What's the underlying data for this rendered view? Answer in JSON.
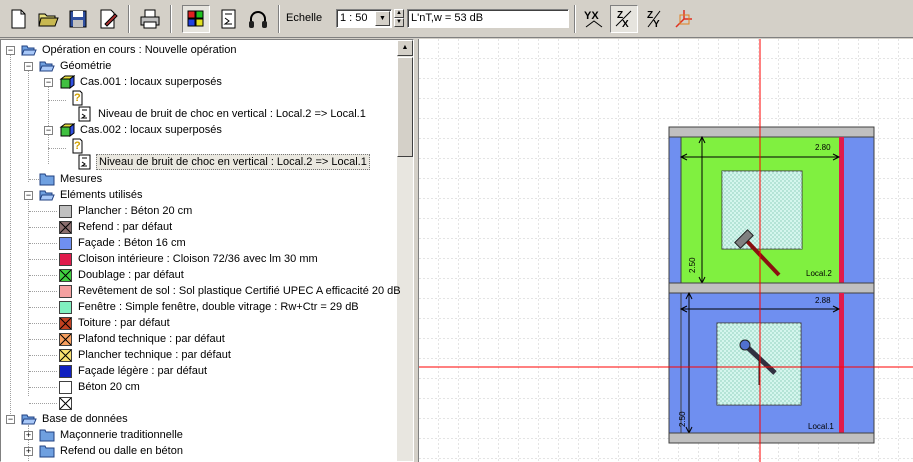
{
  "toolbar": {
    "buttons": [
      {
        "name": "new-document-icon"
      },
      {
        "name": "open-folder-icon"
      },
      {
        "name": "save-icon"
      },
      {
        "name": "edit-document-icon"
      },
      {
        "name": "print-icon"
      },
      {
        "name": "materials-icon",
        "pressed": true
      },
      {
        "name": "calculator-icon"
      },
      {
        "name": "headphones-icon"
      }
    ],
    "view_buttons": [
      {
        "name": "view-yx-icon",
        "label": "YX"
      },
      {
        "name": "view-zx-icon",
        "label": "ZX",
        "pressed": true
      },
      {
        "name": "view-zy-icon",
        "label": "ZY"
      },
      {
        "name": "view-3d-icon",
        "label": ""
      }
    ],
    "echelle_label": "Echelle",
    "scale_value": "1 : 50",
    "result_value": "L'nT,w = 53 dB"
  },
  "tree": {
    "root": "Opération en cours : Nouvelle opération",
    "geometrie": "Géométrie",
    "cas1": "Cas.001 : locaux superposés",
    "cas1_child": "Niveau de bruit de choc en vertical : Local.2 => Local.1",
    "cas2": "Cas.002 : locaux superposés",
    "cas2_child": "Niveau de bruit de choc en vertical : Local.2 => Local.1",
    "mesures": "Mesures",
    "elements": "Eléments utilisés",
    "element_items": [
      {
        "label": "Plancher : Béton 20 cm",
        "color": "#c0c0c0",
        "pattern": "none"
      },
      {
        "label": "Refend : par défaut",
        "color": "#8b6e6e",
        "pattern": "cross"
      },
      {
        "label": "Façade : Béton 16 cm",
        "color": "#6f8ff0",
        "pattern": "none"
      },
      {
        "label": "Cloison intérieure : Cloison  72/36 avec lm 30 mm",
        "color": "#e01b4c",
        "pattern": "none"
      },
      {
        "label": "Doublage : par défaut",
        "color": "#40d040",
        "pattern": "cross"
      },
      {
        "label": "Revêtement de sol : Sol plastique Certifié UPEC A efficacité 20 dB",
        "color": "#f4a0a0",
        "pattern": "none"
      },
      {
        "label": "Fenêtre : Simple fenêtre, double vitrage : Rw+Ctr = 29 dB",
        "color": "#80f0c0",
        "pattern": "none"
      },
      {
        "label": "Toiture : par défaut",
        "color": "#c04020",
        "pattern": "cross"
      },
      {
        "label": "Plafond technique : par défaut",
        "color": "#f8a060",
        "pattern": "cross"
      },
      {
        "label": "Plancher technique : par défaut",
        "color": "#f8e070",
        "pattern": "cross"
      },
      {
        "label": "Façade légère : par défaut",
        "color": "#1020c0",
        "pattern": "none"
      },
      {
        "label": "Béton 20 cm",
        "color": "#ffffff",
        "pattern": "none"
      },
      {
        "label": "",
        "color": "#ffffff",
        "pattern": "cross"
      }
    ],
    "base": "Base de données",
    "base_items": [
      "Maçonnerie traditionnelle",
      "Refend ou dalle en béton",
      ""
    ]
  },
  "drawing": {
    "upper_label": "Local.2",
    "lower_label": "Local.1",
    "upper_width_dim": "2.80",
    "lower_width_dim": "2.88",
    "upper_height_dim": "2.50",
    "lower_height_dim": "2.50",
    "colors": {
      "floor": "#c0c0c0",
      "upper_fill": "#80f040",
      "lower_fill": "#6f8ff0",
      "partition": "#e01b4c",
      "window": "#d8f8f0",
      "crosshair": "#ff0000"
    }
  }
}
